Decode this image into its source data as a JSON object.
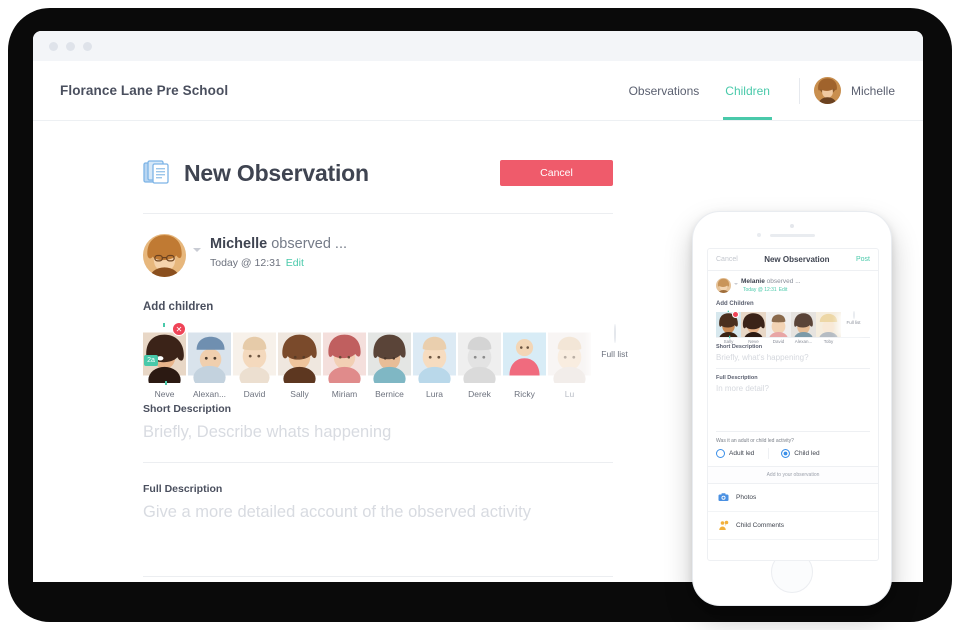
{
  "window": {
    "dots": 3
  },
  "appbar": {
    "brand": "Florance Lane Pre School",
    "nav": [
      {
        "label": "Observations",
        "active": false
      },
      {
        "label": "Children",
        "active": true
      }
    ],
    "user_name": "Michelle",
    "user_avatar_icon": "avatar-michelle"
  },
  "page": {
    "title": "New Observation",
    "title_icon": "documents-icon",
    "cancel_label": "Cancel",
    "author": {
      "name": "Michelle",
      "action_text": " observed ...",
      "timestamp": "Today @ 12:31",
      "edit_label": "Edit",
      "caret_icon": "chevron-down-icon"
    },
    "children_label": "Add children",
    "children": [
      {
        "name": "Neve",
        "selected": true,
        "age_badge": "2a",
        "remove_icon": "close-icon"
      },
      {
        "name": "Alexan...",
        "selected": false
      },
      {
        "name": "David",
        "selected": false
      },
      {
        "name": "Sally",
        "selected": false
      },
      {
        "name": "Miriam",
        "selected": false
      },
      {
        "name": "Bernice",
        "selected": false
      },
      {
        "name": "Lura",
        "selected": false
      },
      {
        "name": "Derek",
        "selected": false
      },
      {
        "name": "Ricky",
        "selected": false
      },
      {
        "name": "Lu",
        "selected": false,
        "faded": true
      }
    ],
    "full_list_label": "Full list",
    "full_list_icon": "plus-icon",
    "short_description": {
      "label": "Short Description",
      "value": "",
      "placeholder": "Briefly, Describe whats happening"
    },
    "full_description": {
      "label": "Full Description",
      "value": "",
      "placeholder": "Give a more detailed account of the observed activity"
    }
  },
  "phone": {
    "navbar": {
      "cancel_label": "Cancel",
      "title": "New Observation",
      "post_label": "Post"
    },
    "author": {
      "name": "Melanie",
      "action_text": " observed ...",
      "timestamp": "Today @ 12:31",
      "edit_label": "Edit"
    },
    "children_label": "Add Children",
    "children": [
      {
        "name": "Sally",
        "selected": true,
        "remove_icon": "close-icon"
      },
      {
        "name": "Neve",
        "selected": false
      },
      {
        "name": "David",
        "selected": false
      },
      {
        "name": "Alexan...",
        "selected": false
      },
      {
        "name": "Toby",
        "selected": false,
        "faded": true
      }
    ],
    "full_list_label": "Full list",
    "full_list_icon": "plus-icon",
    "short_description": {
      "label": "Short Description",
      "value": "",
      "placeholder": "Briefly, what's happening?"
    },
    "full_description": {
      "label": "Full Description",
      "value": "",
      "placeholder": "In more detail?"
    },
    "question": "Was it an adult or child led activity?",
    "radios": [
      {
        "label": "Adult led",
        "selected": false
      },
      {
        "label": "Child led",
        "selected": true
      }
    ],
    "add_header": "Add to your observation",
    "actions": [
      {
        "label": "Photos",
        "icon": "camera-icon"
      },
      {
        "label": "Child Comments",
        "icon": "child-comment-icon"
      }
    ]
  },
  "colors": {
    "accent_teal": "#49c9aa",
    "danger_red": "#ef5b6b",
    "badge_red": "#ef4457",
    "radio_blue": "#3b8fe8",
    "icon_blue": "#7db4e6",
    "icon_orange": "#f2b03c",
    "text_dark": "#3f4451",
    "text_muted": "#6d727e",
    "placeholder": "#d8dbe1",
    "backdrop": "#0a0a0a"
  }
}
